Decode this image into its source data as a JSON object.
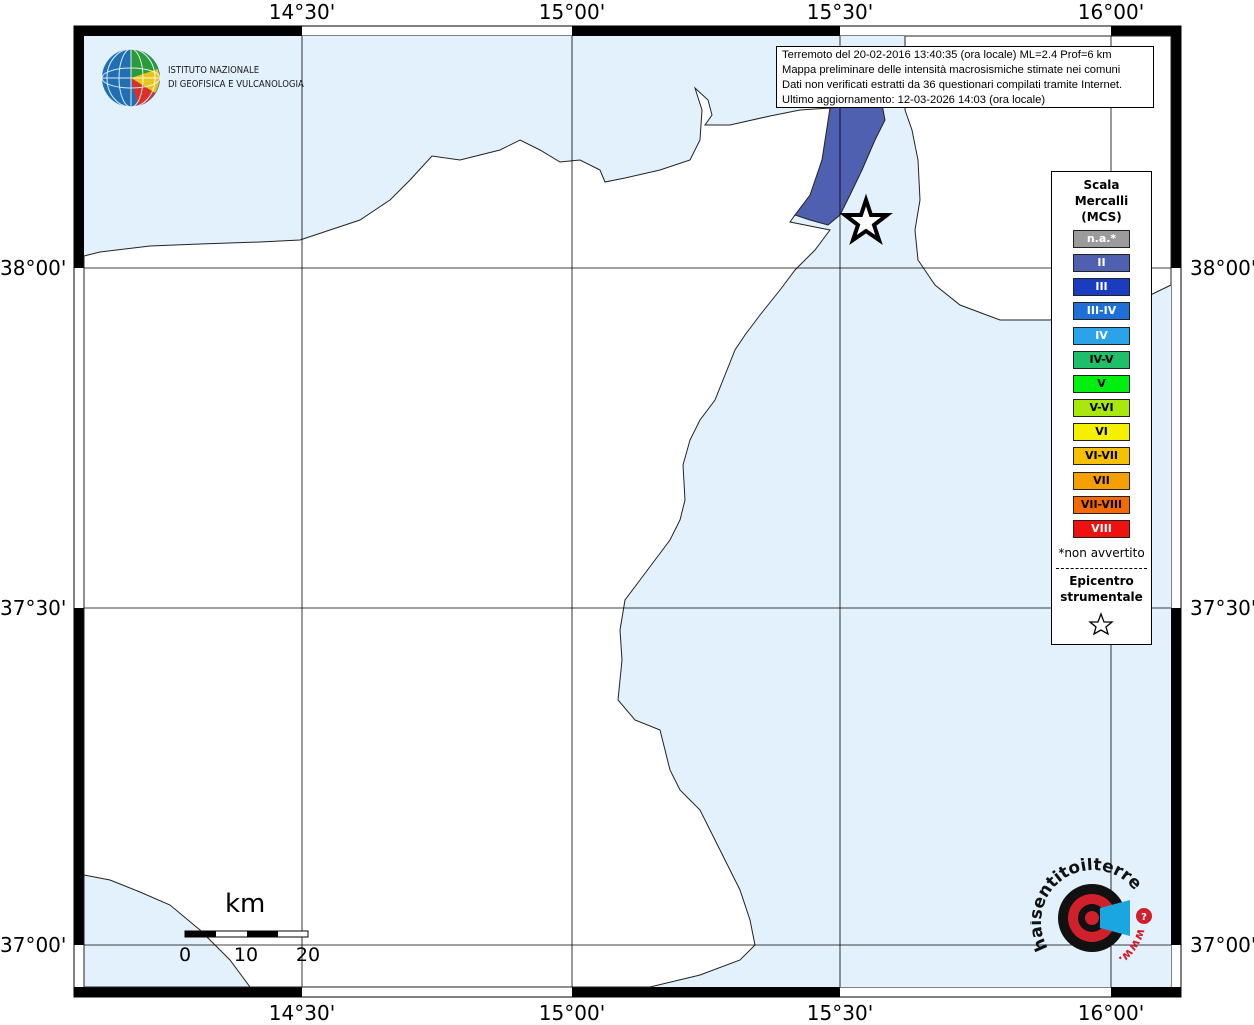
{
  "info": {
    "line1": "Terremoto del 20-02-2016 13:40:35 (ora locale) ML=2.4 Prof=6 km",
    "line2": "Mappa preliminare delle intensità macrosismiche stimate nei comuni",
    "line3": "Dati non verificati estratti da 36 questionari compilati tramite Internet.",
    "line4": "Ultimo aggiornamento: 12-03-2026 14:03 (ora locale)"
  },
  "axes": {
    "lon_labels": [
      "14°30'",
      "15°00'",
      "15°30'",
      "16°00'"
    ],
    "lat_labels": [
      "38°00'",
      "37°30'",
      "37°00'"
    ]
  },
  "legend": {
    "title_lines": [
      "Scala",
      "Mercalli",
      "(MCS)"
    ],
    "classes": [
      {
        "label": "n.a.*",
        "color": "#9b9b9b",
        "text_color": "#ffffff"
      },
      {
        "label": "II",
        "color": "#5060b0",
        "text_color": "#ffffff"
      },
      {
        "label": "III",
        "color": "#1a3cc0",
        "text_color": "#ffffff"
      },
      {
        "label": "III-IV",
        "color": "#1e6fd8",
        "text_color": "#ffffff"
      },
      {
        "label": "IV",
        "color": "#2aa3e8",
        "text_color": "#ffffff"
      },
      {
        "label": "IV-V",
        "color": "#1fbf6a",
        "text_color": "#000000"
      },
      {
        "label": "V",
        "color": "#00ef10",
        "text_color": "#000000"
      },
      {
        "label": "V-VI",
        "color": "#a8e80c",
        "text_color": "#000000"
      },
      {
        "label": "VI",
        "color": "#f5f000",
        "text_color": "#000000"
      },
      {
        "label": "VI-VII",
        "color": "#f5c000",
        "text_color": "#000000"
      },
      {
        "label": "VII",
        "color": "#f5a000",
        "text_color": "#000000"
      },
      {
        "label": "VII-VIII",
        "color": "#f56a00",
        "text_color": "#000000"
      },
      {
        "label": "VIII",
        "color": "#ef1010",
        "text_color": "#ffffff"
      }
    ],
    "na_note": "*non avvertito",
    "epicenter_lines": [
      "Epicentro",
      "strumentale"
    ]
  },
  "logo": {
    "line1": "ISTITUTO NAZIONALE",
    "line2": "DI GEOFISICA E VULCANOLOGIA"
  },
  "scalebar": {
    "title": "km",
    "labels": [
      "0",
      "10",
      "20"
    ]
  },
  "site_logo": {
    "text": "haisentitoilterremoto.it",
    "www": "www."
  },
  "colors": {
    "sea": "#e2f1fc",
    "land": "#ffffff",
    "intensity_II": "#5060b0"
  },
  "epicenter": {
    "lat": 38.04,
    "lon": 15.55
  }
}
